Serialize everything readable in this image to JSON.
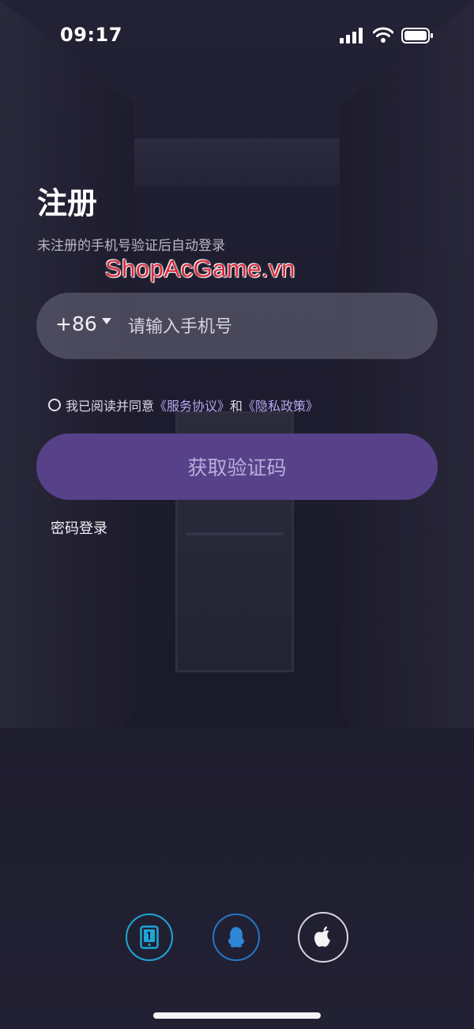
{
  "status_bar": {
    "time": "09:17"
  },
  "form": {
    "title": "注册",
    "subtitle": "未注册的手机号验证后自动登录",
    "watermark": "ShopAcGame.vn",
    "country_code": "+86",
    "phone_placeholder": "请输入手机号",
    "agreement": {
      "prefix": "我已阅读并同意",
      "service_link": "《服务协议》",
      "and": "和",
      "privacy_link": "《隐私政策》"
    },
    "get_code_button": "获取验证码",
    "password_login": "密码登录"
  },
  "social_login": {
    "icons": [
      "phone-number-icon",
      "qq-icon",
      "apple-icon"
    ]
  },
  "colors": {
    "accent_button": "#574189",
    "link": "#b6a6ef",
    "phone_icon_ring": "#1ea6d6",
    "qq_icon_ring": "#2476c8",
    "watermark": "#d42a3c"
  }
}
